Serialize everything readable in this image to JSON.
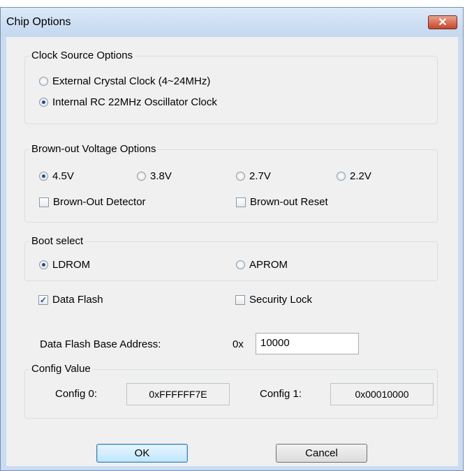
{
  "window": {
    "title": "Chip Options",
    "close_glyph": "✕"
  },
  "clock": {
    "legend": "Clock Source Options",
    "options": [
      {
        "label": "External Crystal Clock (4~24MHz)",
        "selected": false
      },
      {
        "label": "Internal RC 22MHz Oscillator Clock",
        "selected": true
      }
    ]
  },
  "brownout": {
    "legend": "Brown-out Voltage Options",
    "voltages": [
      {
        "label": "4.5V",
        "selected": true
      },
      {
        "label": "3.8V",
        "selected": false
      },
      {
        "label": "2.7V",
        "selected": false
      },
      {
        "label": "2.2V",
        "selected": false
      }
    ],
    "detector": {
      "label": "Brown-Out Detector",
      "checked": false
    },
    "reset": {
      "label": "Brown-out Reset",
      "checked": false
    }
  },
  "boot": {
    "legend": "Boot select",
    "options": [
      {
        "label": "LDROM",
        "selected": true
      },
      {
        "label": "APROM",
        "selected": false
      }
    ]
  },
  "data_flash": {
    "label": "Data Flash",
    "checked": true,
    "check_glyph": "✓"
  },
  "security_lock": {
    "label": "Security Lock",
    "checked": false
  },
  "base_address": {
    "label": "Data Flash Base Address:",
    "prefix": "0x",
    "value": "10000"
  },
  "config": {
    "legend": "Config Value",
    "config0_label": "Config 0:",
    "config0_value": "0xFFFFFF7E",
    "config1_label": "Config 1:",
    "config1_value": "0x00010000"
  },
  "buttons": {
    "ok": "OK",
    "cancel": "Cancel"
  },
  "colors": {
    "frame": "#c9dcf3",
    "client": "#f0f0f0",
    "close_button": "#c8452b",
    "radio_dot": "#1e4f8c"
  }
}
